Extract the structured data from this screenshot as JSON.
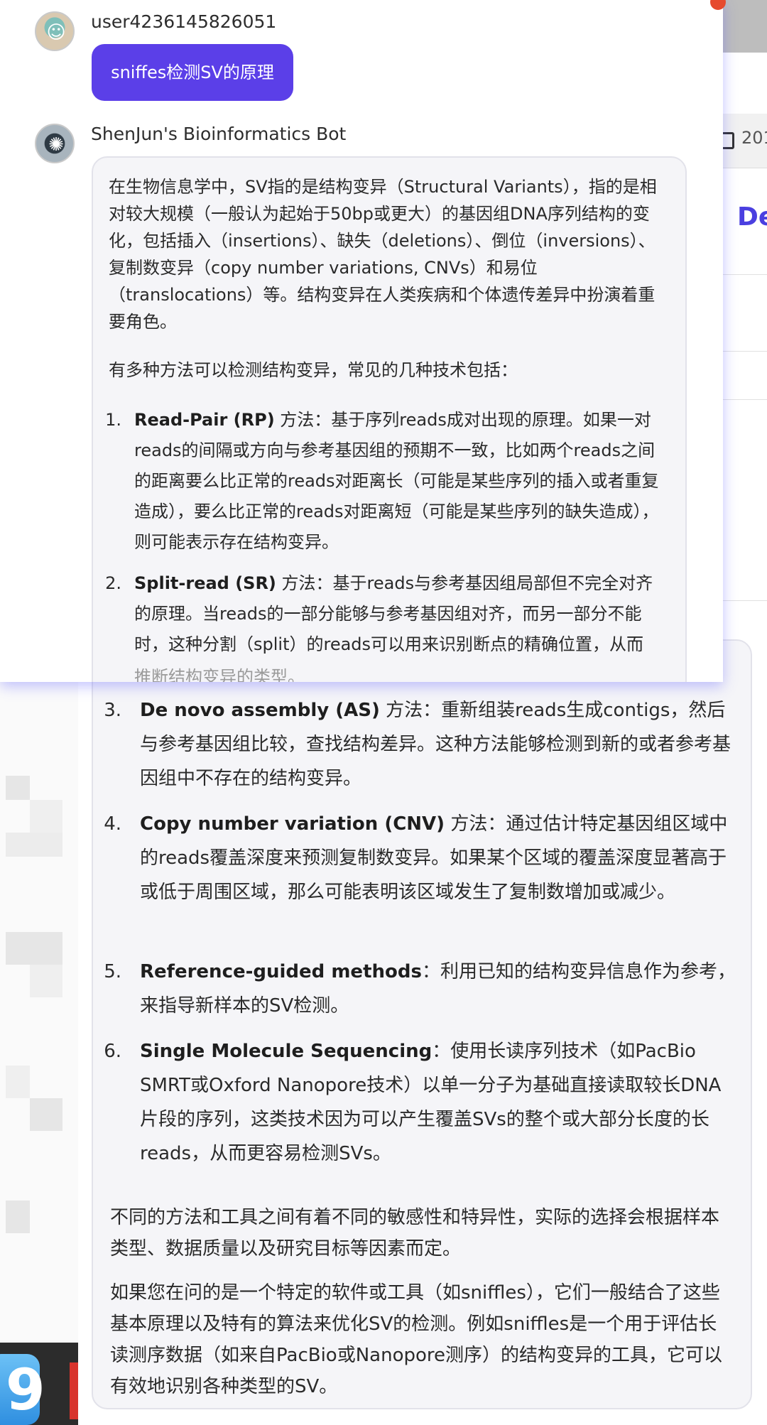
{
  "background_app": {
    "tab_date": "201",
    "heading_fragment": "De"
  },
  "chat": {
    "user": {
      "name": "user4236145826051",
      "message": "sniffes检测SV的原理"
    },
    "bot": {
      "name": "ShenJun's Bioinformatics Bot",
      "intro": "在生物信息学中，SV指的是结构变异（Structural Variants），指的是相对较大规模（一般认为起始于50bp或更大）的基因组DNA序列结构的变化，包括插入（insertions）、缺失（deletions）、倒位（inversions）、复制数变异（copy number variations, CNVs）和易位（translocations）等。结构变异在人类疾病和个体遗传差异中扮演着重要角色。",
      "methods_intro": "有多种方法可以检测结构变异，常见的几种技术包括：",
      "methods": [
        {
          "num": "1.",
          "title": "Read-Pair (RP)",
          "text": " 方法：基于序列reads成对出现的原理。如果一对reads的间隔或方向与参考基因组的预期不一致，比如两个reads之间的距离要么比正常的reads对距离长（可能是某些序列的插入或者重复造成），要么比正常的reads对距离短（可能是某些序列的缺失造成），则可能表示存在结构变异。"
        },
        {
          "num": "2.",
          "title": "Split-read (SR)",
          "text": " 方法：基于reads与参考基因组局部但不完全对齐的原理。当reads的一部分能够与参考基因组对齐，而另一部分不能时，这种分割（split）的reads可以用来识别断点的精确位置，从而",
          "fade": "推断结构变异的类型。"
        },
        {
          "num": "3.",
          "title": "De novo assembly (AS)",
          "text": " 方法：重新组装reads生成contigs，然后与参考基因组比较，查找结构差异。这种方法能够检测到新的或者参考基因组中不存在的结构变异。"
        },
        {
          "num": "4.",
          "title": "Copy number variation (CNV)",
          "text": " 方法：通过估计特定基因组区域中的reads覆盖深度来预测复制数变异。如果某个区域的覆盖深度显著高于或低于周围区域，那么可能表明该区域发生了复制数增加或减少。"
        },
        {
          "num": "5.",
          "title": "Reference-guided methods",
          "text": "：利用已知的结构变异信息作为参考，来指导新样本的SV检测。"
        },
        {
          "num": "6.",
          "title": "Single Molecule Sequencing",
          "text": "：使用长读序列技术（如PacBio SMRT或Oxford Nanopore技术）以单一分子为基础直接读取较长DNA片段的序列，这类技术因为可以产生覆盖SVs的整个或大部分长度的长reads，从而更容易检测SVs。"
        }
      ],
      "conclusion_1": "不同的方法和工具之间有着不同的敏感性和特异性，实际的选择会根据样本类型、数据质量以及研究目标等因素而定。",
      "conclusion_2": "如果您在问的是一个特定的软件或工具（如sniffles），它们一般结合了这些基本原理以及特有的算法来优化SV的检测。例如sniffles是一个用于评估长读测序数据（如来自PacBio或Nanopore测序）的结构变异的工具，它可以有效地识别各种类型的SV。"
    }
  },
  "icons": {
    "user_avatar": "user-avatar",
    "bot_avatar": "bot-avatar",
    "dock_app": "finder-icon"
  },
  "colors": {
    "accent": "#5b3fe8",
    "card_bg": "#f5f5f8",
    "heading_fragment": "#4a3fe0"
  }
}
